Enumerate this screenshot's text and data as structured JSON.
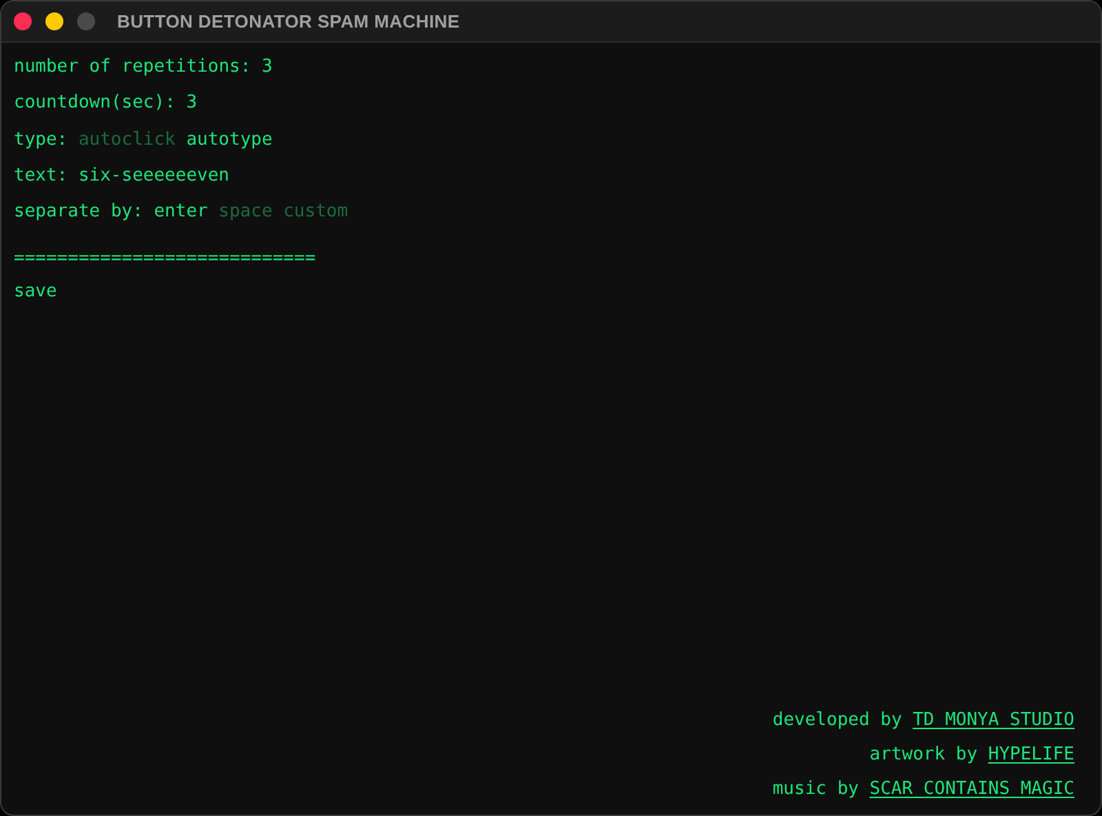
{
  "window": {
    "title": "BUTTON DETONATOR SPAM MACHINE"
  },
  "settings": [
    {
      "kind": "value",
      "label": "number of repetitions:",
      "value": "3"
    },
    {
      "kind": "value",
      "label": "countdown(sec):",
      "value": "3"
    },
    {
      "kind": "choice",
      "label": "type:",
      "options": [
        {
          "label": "autoclick",
          "selected": false
        },
        {
          "label": "autotype",
          "selected": true
        }
      ]
    },
    {
      "kind": "value",
      "label": "text:",
      "value": "six-seeeeeeven"
    },
    {
      "kind": "choice",
      "label": "separate by:",
      "options": [
        {
          "label": "enter",
          "selected": true
        },
        {
          "label": "space",
          "selected": false
        },
        {
          "label": "custom",
          "selected": false
        }
      ]
    }
  ],
  "divider": "============================",
  "save_label": "save",
  "credits": [
    {
      "text": "developed by",
      "link": "TD MONYA STUDIO"
    },
    {
      "text": "artwork by",
      "link": "HYPELIFE"
    },
    {
      "text": "music by",
      "link": "SCAR CONTAINS MAGIC"
    }
  ]
}
